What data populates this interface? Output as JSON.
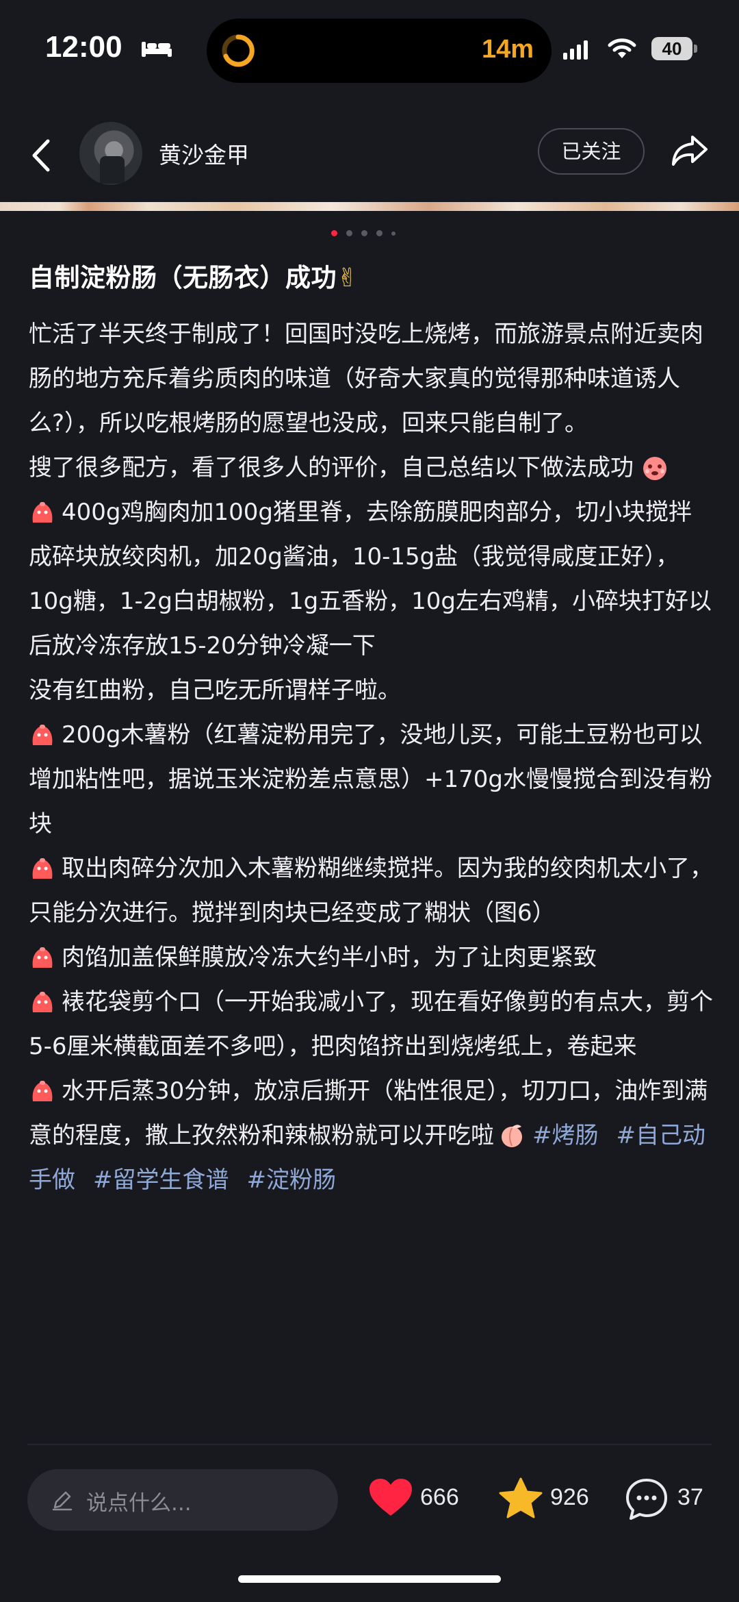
{
  "status_bar": {
    "time": "12:00",
    "timer": "14m",
    "battery": "40"
  },
  "header": {
    "author": "黄沙金甲",
    "follow_label": "已关注"
  },
  "carousel": {
    "count": 5,
    "active_index": 0
  },
  "post": {
    "title": "自制淀粉肠（无肠衣）成功",
    "title_emoji": "✌",
    "intro": "忙活了半天终于制成了！回国时没吃上烧烤，而旅游景点附近卖肉肠的地方充斥着劣质肉的味道（好奇大家真的觉得那种味道诱人么?），所以吃根烤肠的愿望也没成，回来只能自制了。",
    "p2": "搜了很多配方，看了很多人的评价，自己总结以下做法成功",
    "step1": "400g鸡胸肉加100g猪里脊，去除筋膜肥肉部分，切小块搅拌成碎块放绞肉机，加20g酱油，10-15g盐（我觉得咸度正好），10g糖，1-2g白胡椒粉，1g五香粉，10g左右鸡精，小碎块打好以后放冷冻存放15-20分钟冷凝一下",
    "note": "没有红曲粉，自己吃无所谓样子啦。",
    "step2": "200g木薯粉（红薯淀粉用完了，没地儿买，可能土豆粉也可以增加粘性吧，据说玉米淀粉差点意思）+170g水慢慢搅合到没有粉块",
    "step3": "取出肉碎分次加入木薯粉糊继续搅拌。因为我的绞肉机太小了，只能分次进行。搅拌到肉块已经变成了糊状（图6）",
    "step4": "肉馅加盖保鲜膜放冷冻大约半小时，为了让肉更紧致",
    "step5": "裱花袋剪个口（一开始我减小了，现在看好像剪的有点大，剪个5-6厘米横截面差不多吧），把肉馅挤出到烧烤纸上，卷起来",
    "step6": "水开后蒸30分钟，放凉后撕开（粘性很足），切刀口，油炸到满意的程度，撒上孜然粉和辣椒粉就可以开吃啦",
    "tags": [
      "#烤肠",
      "#自己动手做",
      "#留学生食谱",
      "#淀粉肠"
    ]
  },
  "bottom_bar": {
    "comment_placeholder": "说点什么...",
    "likes": "666",
    "favorites": "926",
    "comments": "37",
    "like_color": "#ff2442",
    "favorite_color": "#f7b928"
  }
}
